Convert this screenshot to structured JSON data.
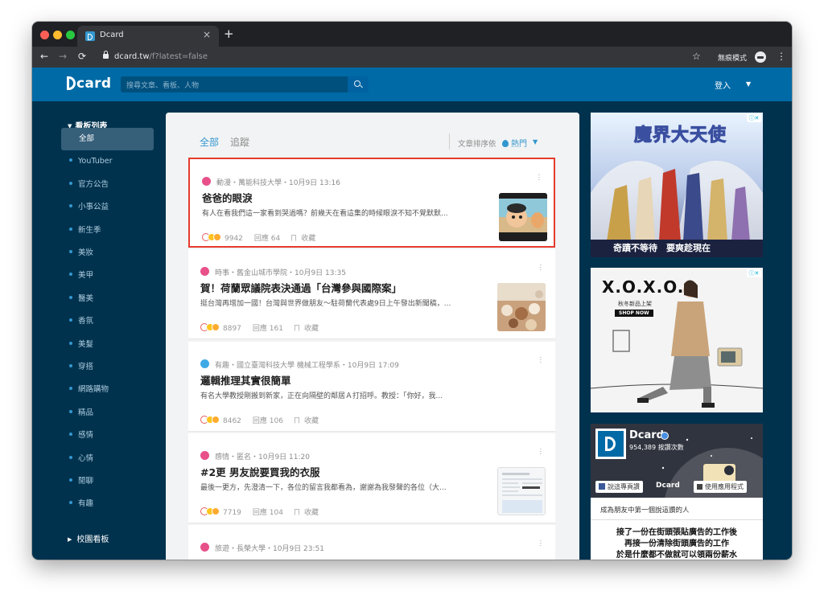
{
  "browser": {
    "tab_title": "Dcard",
    "tab_close": "×",
    "new_tab": "+",
    "url_host": "dcard.tw",
    "url_path": "/f?latest=false",
    "incognito_label": "無痕模式"
  },
  "header": {
    "logo": "card",
    "search_placeholder": "搜尋文章、看板、人物",
    "login": "登入"
  },
  "sidebar": {
    "section_title": "看板列表",
    "items": [
      {
        "label": "全部",
        "active": true
      },
      {
        "label": "YouTuber"
      },
      {
        "label": "官方公告"
      },
      {
        "label": "小事公益"
      },
      {
        "label": "新生季"
      },
      {
        "label": "美妝"
      },
      {
        "label": "美甲"
      },
      {
        "label": "醫美"
      },
      {
        "label": "香氛"
      },
      {
        "label": "美髮"
      },
      {
        "label": "穿搭"
      },
      {
        "label": "網路購物"
      },
      {
        "label": "精品"
      },
      {
        "label": "感情"
      },
      {
        "label": "心情"
      },
      {
        "label": "閒聊"
      },
      {
        "label": "有趣"
      }
    ],
    "footer": "校園看板"
  },
  "feed": {
    "tab_all": "全部",
    "tab_follow": "追蹤",
    "sort_label": "文章排序依",
    "sort_value": "熱門",
    "posts": [
      {
        "meta": "動漫・萬能科技大學・10月9日 13:16",
        "title": "爸爸的眼淚",
        "excerpt": "有人在看我們這一家看到哭過嗎？前幾天在看這集的時候眼淚不知不覺默默...",
        "likes": "9942",
        "replies": "回應 64",
        "save": "收藏",
        "avatar_color": "#e8508a"
      },
      {
        "meta": "時事・舊金山城市學院・10月9日 13:35",
        "title": "賀！荷蘭眾議院表決通過「台灣參與國際案」",
        "excerpt": "挺台灣再增加一國！台灣與世界做朋友～駐荷蘭代表處9日上午發出新聞稿，...",
        "likes": "8897",
        "replies": "回應 161",
        "save": "收藏",
        "avatar_color": "#e8508a"
      },
      {
        "meta": "有趣・國立臺灣科技大學 機械工程學系・10月9日 17:09",
        "title": "邏輯推理其實很簡單",
        "excerpt": "有名大學教授剛搬到新家，正在向隔壁的鄰居Ａ打招呼。教授：「你好，我...",
        "likes": "8462",
        "replies": "回應 106",
        "save": "收藏",
        "avatar_color": "#3fa9e6"
      },
      {
        "meta": "感情・匿名・10月9日 11:20",
        "title": "#2更 男友說要買我的衣服",
        "excerpt": "最後一更方，先澄清一下，各位的留言我都看為，謝謝為我發聲的各位（大...",
        "likes": "7719",
        "replies": "回應 104",
        "save": "收藏",
        "avatar_color": "#e8508a"
      },
      {
        "meta": "旅遊・長榮大學・10月9日 23:51",
        "avatar_color": "#e8508a"
      }
    ]
  },
  "ads": {
    "ad1_title": "魔界大天使",
    "ad1_caption": "奇蹟不等待　要爽趁現在",
    "ad2_brand": "X.O.X.O.",
    "ad2_sub": "秋冬新品上架",
    "ad2_btn": "SHOP NOW"
  },
  "facebook": {
    "page_name": "Dcard",
    "likes": "954,389 按讚次數",
    "like_btn": "說這專頁讚",
    "app_btn": "使用應用程式",
    "friend_text": "成為朋友中第一個說這讚的人",
    "post_lines": [
      "接了一份在街頭張貼廣告的工作後",
      "再接一份清除街頭廣告的工作",
      "於是什麼都不做就可以領兩份薪水"
    ]
  },
  "colors": {
    "brand": "#006aa6",
    "bg": "#00324e",
    "accent": "#3397cf",
    "highlight": "#e53b2c"
  }
}
